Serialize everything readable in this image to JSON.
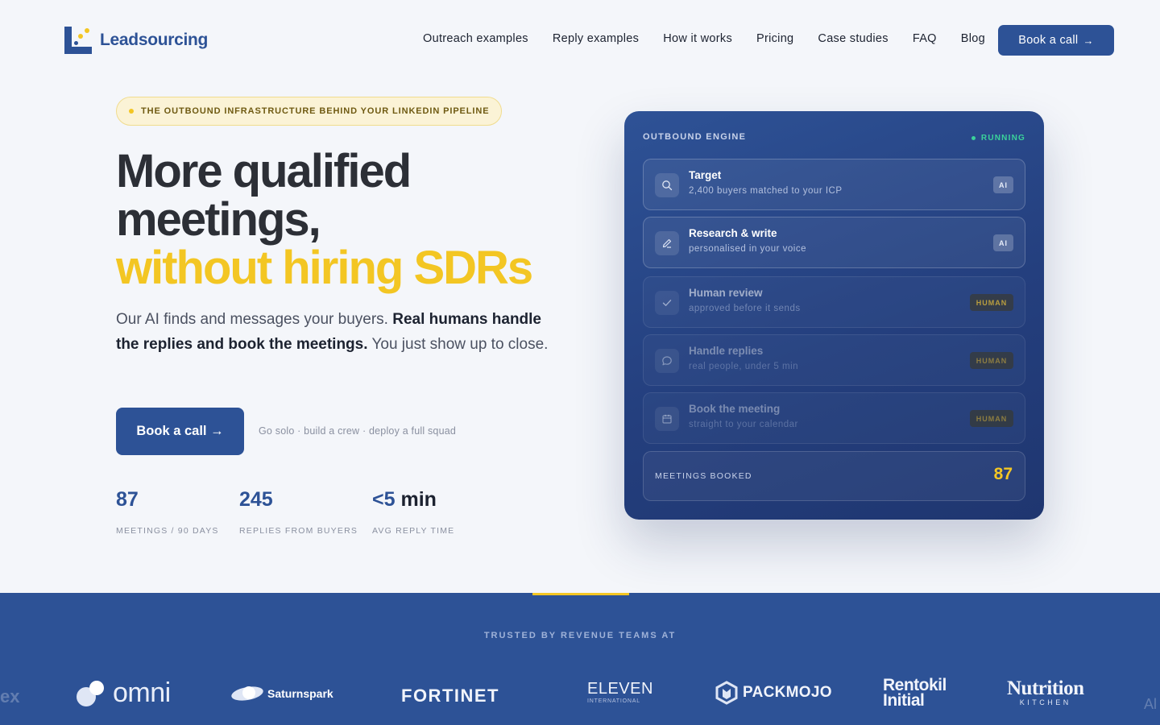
{
  "brand": {
    "name": "Leadsourcing"
  },
  "nav": {
    "links": [
      "Outreach examples",
      "Reply examples",
      "How it works",
      "Pricing",
      "Case studies",
      "FAQ",
      "Blog"
    ],
    "cta": "Book a call",
    "cta_arrow": "→"
  },
  "hero": {
    "badge": "THE OUTBOUND INFRASTRUCTURE BEHIND YOUR LINKEDIN PIPELINE",
    "headline_line1": "More qualified",
    "headline_line2": "meetings,",
    "headline_highlight": "without hiring SDRs",
    "sub_part1": "Our AI finds and messages your buyers. ",
    "sub_bold": "Real humans handle the replies and book the meetings.",
    "sub_part2": " You just show up to close.",
    "cta": "Book a call →",
    "cta_note": "Go solo · build a crew · deploy a full squad",
    "stats": [
      {
        "value": "87",
        "unit": "",
        "label": "MEETINGS / 90 DAYS"
      },
      {
        "value": "245",
        "unit": "",
        "label": "REPLIES FROM BUYERS"
      },
      {
        "value": "<5",
        "unit": " min",
        "label": "AVG REPLY TIME"
      }
    ]
  },
  "engine": {
    "title": "OUTBOUND ENGINE",
    "status": "RUNNING",
    "steps": [
      {
        "icon": "search-icon",
        "title": "Target",
        "desc": "2,400 buyers matched to your ICP",
        "tag": "AI"
      },
      {
        "icon": "pencil-icon",
        "title": "Research & write",
        "desc": "personalised in your voice",
        "tag": "AI"
      },
      {
        "icon": "check-icon",
        "title": "Human review",
        "desc": "approved before it sends",
        "tag": "HUMAN"
      },
      {
        "icon": "chat-bubble-icon",
        "title": "Handle replies",
        "desc": "real people, under 5 min",
        "tag": "HUMAN"
      },
      {
        "icon": "calendar-icon",
        "title": "Book the meeting",
        "desc": "straight to your calendar",
        "tag": "HUMAN"
      }
    ],
    "meetings_label": "MEETINGS BOOKED",
    "meetings_value": "87"
  },
  "trusted": {
    "title": "TRUSTED BY REVENUE TEAMS AT",
    "logos": [
      "omni",
      "Saturnspark",
      "FORTINET",
      "ELEVEN",
      "INTERNATIONAL",
      "PACKMOJO",
      "Rentokil",
      "Initial",
      "Nutrition",
      "KITCHEN"
    ]
  },
  "colors": {
    "primary": "#2d5296",
    "accent": "#f3c623",
    "running": "#3ad29a",
    "text": "#1c2230"
  }
}
